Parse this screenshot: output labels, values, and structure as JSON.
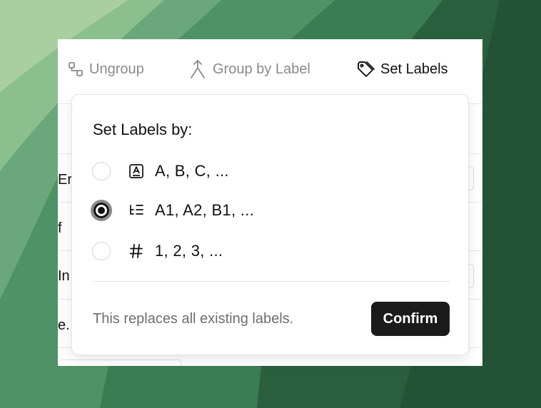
{
  "toolbar": {
    "ungroup": {
      "label": "Ungroup",
      "icon": "ungroup-icon"
    },
    "group_by_label": {
      "label": "Group by Label",
      "icon": "merge-arrow-icon"
    },
    "set_labels": {
      "label": "Set Labels",
      "icon": "tag-icon"
    }
  },
  "background_form": {
    "labels": [
      "Er",
      "f",
      "In",
      "e."
    ]
  },
  "popover": {
    "title": "Set Labels by:",
    "options": [
      {
        "label": "A, B, C, ...",
        "icon": "letter-a-icon",
        "selected": false
      },
      {
        "label": "A1, A2, B1, ...",
        "icon": "nested-list-icon",
        "selected": true
      },
      {
        "label": "1, 2, 3, ...",
        "icon": "hash-icon",
        "selected": false
      }
    ],
    "hint": "This replaces all existing labels.",
    "confirm_label": "Confirm"
  },
  "colors": {
    "accent_dark": "#1b1b1b",
    "muted_text": "#8a8a8a",
    "background_green": "#2f6b45"
  }
}
